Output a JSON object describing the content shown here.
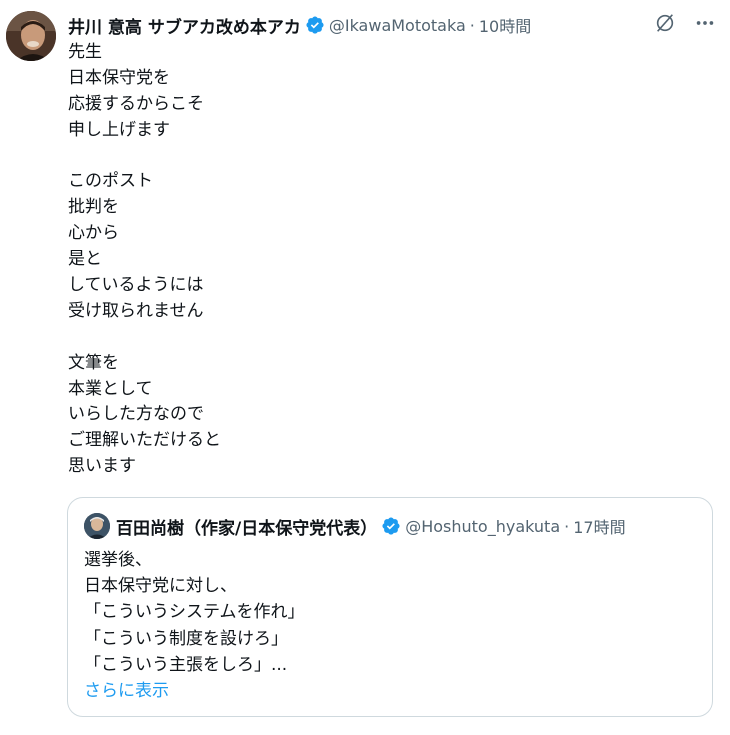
{
  "post": {
    "author_name": "井川 意高 サブアカ改め本アカ",
    "handle": "@IkawaMototaka",
    "separator": "·",
    "time": "10時間",
    "icon_names": [
      "grok-icon",
      "more-icon",
      "verified-badge-icon"
    ],
    "body_lines": [
      "先生",
      "日本保守党を",
      "応援するからこそ",
      "申し上げます",
      "",
      "このポスト",
      "批判を",
      "心から",
      "是と",
      "しているようには",
      "受け取られません",
      "",
      "文筆を",
      "本業として",
      "いらした方なので",
      "ご理解いただけると",
      "思います"
    ]
  },
  "quote": {
    "author_name": "百田尚樹（作家/日本保守党代表）",
    "handle": "@Hoshuto_hyakuta",
    "separator": "·",
    "time": "17時間",
    "body_lines": [
      "選挙後、",
      "日本保守党に対し、",
      "「こういうシステムを作れ」",
      "「こういう制度を設けろ」",
      "「こういう主張をしろ」..."
    ],
    "show_more": "さらに表示"
  },
  "colors": {
    "text": "#0f1419",
    "secondary": "#536471",
    "link": "#1d9bf0",
    "verified": "#1d9bf0",
    "border": "#cfd9de"
  }
}
